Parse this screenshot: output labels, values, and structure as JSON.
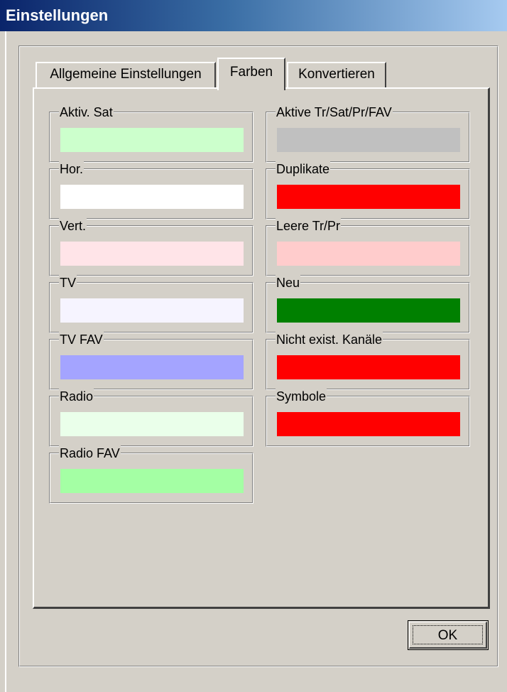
{
  "window": {
    "title": "Einstellungen"
  },
  "tabs": [
    {
      "label": "Allgemeine Einstellungen",
      "selected": false
    },
    {
      "label": "Farben",
      "selected": true
    },
    {
      "label": "Konvertieren",
      "selected": false
    }
  ],
  "colors": {
    "left": [
      {
        "label": "Aktiv. Sat",
        "color": "#ccffcc"
      },
      {
        "label": "Hor.",
        "color": "#ffffff"
      },
      {
        "label": "Vert.",
        "color": "#ffe4e8"
      },
      {
        "label": "TV",
        "color": "#f6f4ff"
      },
      {
        "label": "TV FAV",
        "color": "#a4a4ff"
      },
      {
        "label": "Radio",
        "color": "#eaffea"
      },
      {
        "label": "Radio FAV",
        "color": "#a4ffa4"
      }
    ],
    "right": [
      {
        "label": "Aktive Tr/Sat/Pr/FAV",
        "color": "#c0c0c0"
      },
      {
        "label": "Duplikate",
        "color": "#ff0000"
      },
      {
        "label": "Leere Tr/Pr",
        "color": "#ffcccc"
      },
      {
        "label": "Neu",
        "color": "#008000"
      },
      {
        "label": "Nicht exist. Kanäle",
        "color": "#ff0000"
      },
      {
        "label": "Symbole",
        "color": "#ff0000"
      }
    ]
  },
  "buttons": {
    "ok_label": "OK"
  }
}
